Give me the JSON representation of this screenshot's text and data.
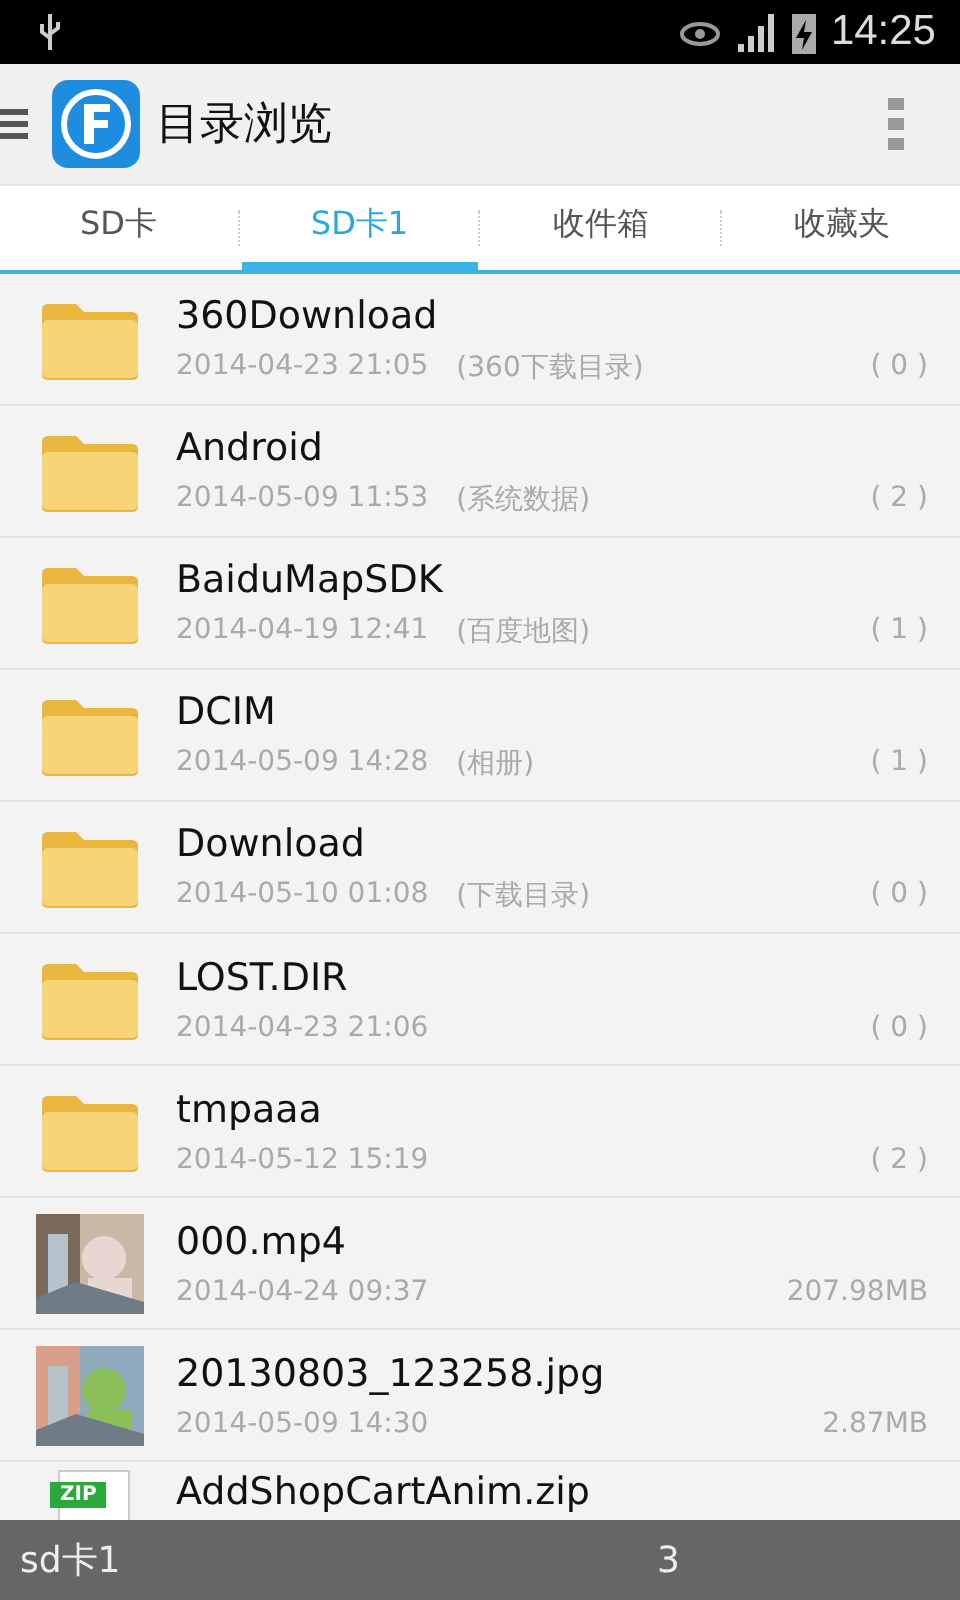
{
  "status_bar": {
    "time": "14:25"
  },
  "app_bar": {
    "title": "目录浏览"
  },
  "tabs": [
    {
      "label": "SD卡",
      "selected": false
    },
    {
      "label": "SD卡1",
      "selected": true
    },
    {
      "label": "收件箱",
      "selected": false
    },
    {
      "label": "收藏夹",
      "selected": false
    }
  ],
  "files": [
    {
      "kind": "folder",
      "name": "360Download",
      "date": "2014-04-23 21:05",
      "note": "(360下载目录)",
      "size": "( 0 )"
    },
    {
      "kind": "folder",
      "name": "Android",
      "date": "2014-05-09 11:53",
      "note": "(系统数据)",
      "size": "( 2 )"
    },
    {
      "kind": "folder",
      "name": "BaiduMapSDK",
      "date": "2014-04-19 12:41",
      "note": "(百度地图)",
      "size": "( 1 )"
    },
    {
      "kind": "folder",
      "name": "DCIM",
      "date": "2014-05-09 14:28",
      "note": "(相册)",
      "size": "( 1 )"
    },
    {
      "kind": "folder",
      "name": "Download",
      "date": "2014-05-10 01:08",
      "note": "(下载目录)",
      "size": "( 0 )"
    },
    {
      "kind": "folder",
      "name": "LOST.DIR",
      "date": "2014-04-23 21:06",
      "size": "( 0 )"
    },
    {
      "kind": "folder",
      "name": "tmpaaa",
      "date": "2014-05-12 15:19",
      "size": "( 2 )"
    },
    {
      "kind": "picture",
      "name": "000.mp4",
      "date": "2014-04-24 09:37",
      "size": "207.98MB"
    },
    {
      "kind": "picture",
      "name": "20130803_123258.jpg",
      "date": "2014-05-09 14:30",
      "size": "2.87MB"
    },
    {
      "kind": "zip",
      "badge": "ZIP",
      "name": "AddShopCartAnim.zip"
    }
  ],
  "bottom_bar": {
    "location": "sd卡1",
    "info": "3"
  }
}
